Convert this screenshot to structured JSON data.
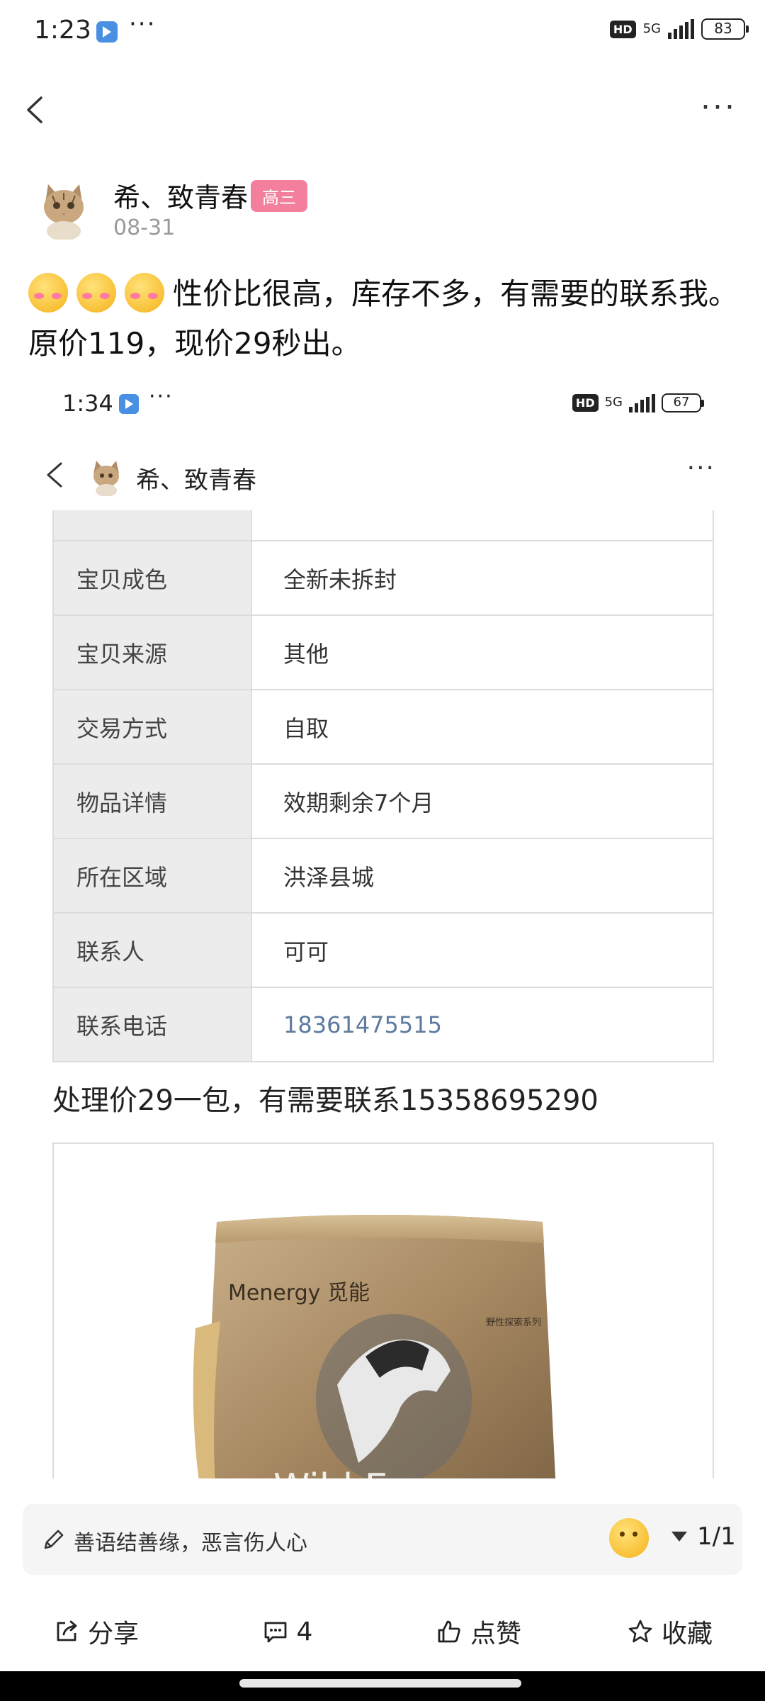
{
  "status_bar": {
    "time": "1:23",
    "network": "5G",
    "battery": "83"
  },
  "post": {
    "author": "希、致青春",
    "badge": "高三",
    "date": "08-31",
    "text": "性价比很高，库存不多，有需要的联系我。原价119，现价29秒出。"
  },
  "screenshot": {
    "status_bar": {
      "time": "1:34",
      "network": "5G",
      "battery": "67"
    },
    "nav_name": "希、致青春",
    "table": [
      {
        "key": "宝贝成色",
        "value": "全新未拆封"
      },
      {
        "key": "宝贝来源",
        "value": "其他"
      },
      {
        "key": "交易方式",
        "value": "自取"
      },
      {
        "key": "物品详情",
        "value": "效期剩余7个月"
      },
      {
        "key": "所在区域",
        "value": "洪泽县城"
      },
      {
        "key": "联系人",
        "value": "可可"
      },
      {
        "key": "联系电话",
        "value": "18361475515"
      }
    ],
    "price_line": "处理价29一包，有需要联系15358695290",
    "product_brand": "Menergy 觅能",
    "product_series": "野性探索系列",
    "product_text": "Wild Energy"
  },
  "comment": {
    "placeholder": "善语结善缘，恶言伤人心",
    "page": "1/1"
  },
  "actions": {
    "share": "分享",
    "comments": "4",
    "like": "点赞",
    "favorite": "收藏"
  },
  "colors": {
    "badge": "#f37f9c",
    "link": "#5e7a9e",
    "table_key_bg": "#ececec"
  }
}
